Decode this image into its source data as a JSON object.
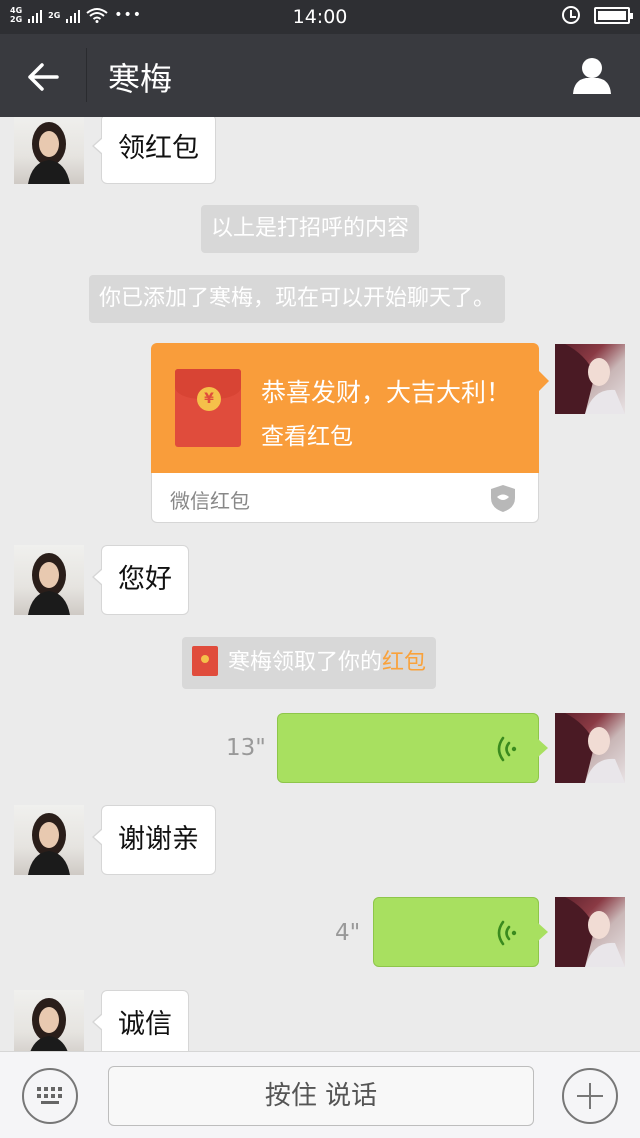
{
  "status_bar": {
    "network_top": "4G",
    "network_bottom": "2G",
    "network2": "2G",
    "more": "•••",
    "time": "14:00"
  },
  "header": {
    "title": "寒梅",
    "back_icon": "arrow-left-icon",
    "profile_icon": "person-icon"
  },
  "messages": {
    "m1": "领红包",
    "sys1": "以上是打招呼的内容",
    "sys2": "你已添加了寒梅，现在可以开始聊天了。",
    "packet": {
      "greeting": "恭喜发财，大吉大利！",
      "action": "查看红包",
      "label": "微信红包",
      "coin": "¥"
    },
    "m2": "您好",
    "sys3_prefix": "寒梅领取了你的",
    "sys3_link": "红包",
    "voice1_duration": "13\"",
    "m3": "谢谢亲",
    "voice2_duration": "4\"",
    "m4": "诚信"
  },
  "bottom_bar": {
    "talk_label": "按住 说话",
    "keyboard_icon": "keyboard-icon",
    "plus_icon": "plus-icon"
  },
  "colors": {
    "header_bg": "#393a3f",
    "chat_bg": "#ebebeb",
    "packet_orange": "#f99d3b",
    "voice_green": "#a8e060",
    "highlight": "#f9a23c"
  }
}
